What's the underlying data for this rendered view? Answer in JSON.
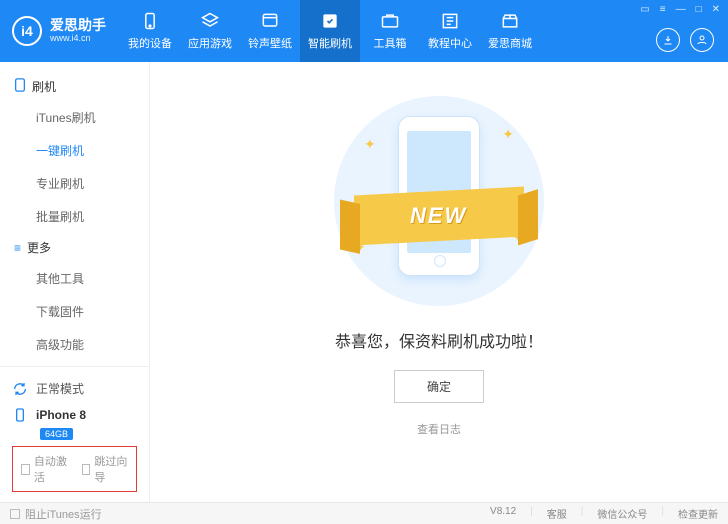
{
  "header": {
    "logo_text": "爱思助手",
    "logo_sub": "www.i4.cn",
    "logo_badge": "i4",
    "nav": [
      {
        "label": "我的设备"
      },
      {
        "label": "应用游戏"
      },
      {
        "label": "铃声壁纸"
      },
      {
        "label": "智能刷机",
        "active": true
      },
      {
        "label": "工具箱"
      },
      {
        "label": "教程中心"
      },
      {
        "label": "爱思商城"
      }
    ],
    "win": [
      "▭",
      "≡",
      "—",
      "□",
      "✕"
    ]
  },
  "sidebar": {
    "group1": {
      "title": "刷机",
      "items": [
        "iTunes刷机",
        "一键刷机",
        "专业刷机",
        "批量刷机"
      ],
      "active_index": 1
    },
    "group2": {
      "title": "更多",
      "items": [
        "其他工具",
        "下载固件",
        "高级功能"
      ]
    },
    "mode": "正常模式",
    "device": {
      "name": "iPhone 8",
      "storage": "64GB"
    },
    "checks": {
      "auto_activate": "自动激活",
      "skip_guide": "跳过向导"
    }
  },
  "main": {
    "ribbon": "NEW",
    "success": "恭喜您，保资料刷机成功啦！",
    "ok": "确定",
    "log": "查看日志"
  },
  "footer": {
    "block_itunes": "阻止iTunes运行",
    "version": "V8.12",
    "links": [
      "客服",
      "微信公众号",
      "检查更新"
    ]
  }
}
